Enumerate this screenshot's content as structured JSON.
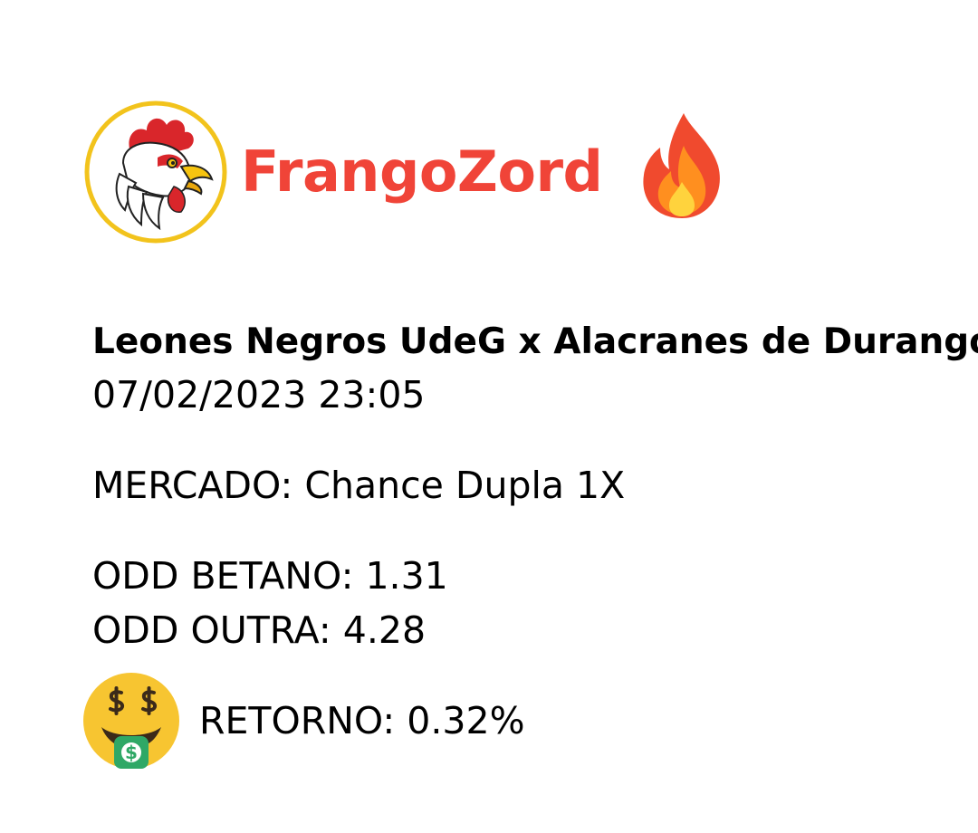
{
  "header": {
    "logo_icon": "rooster-logo-icon",
    "brand_name": "FrangoZord",
    "brand_color": "#f04438",
    "decor_icon": "fire-icon"
  },
  "match": {
    "teams": "Leones Negros UdeG x Alacranes de Durango",
    "datetime": "07/02/2023 23:05"
  },
  "market": {
    "label": "MERCADO:",
    "value": "Chance Dupla 1X"
  },
  "odds": {
    "betano_label": "ODD BETANO:",
    "betano_value": "1.31",
    "outra_label": "ODD OUTRA:",
    "outra_value": "4.28"
  },
  "retorno": {
    "icon": "money-mouth-face-icon",
    "label": "RETORNO:",
    "value": "0.32%"
  }
}
